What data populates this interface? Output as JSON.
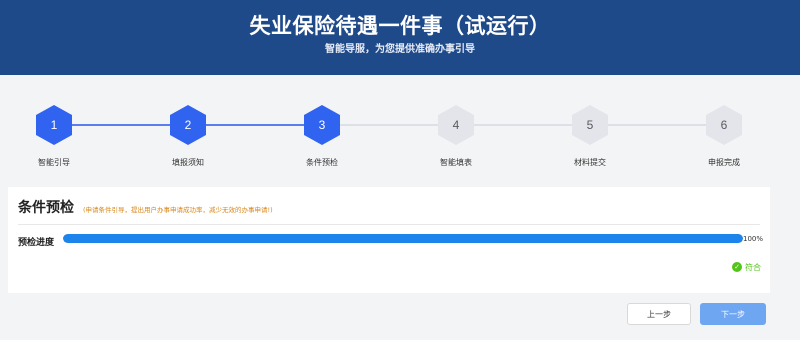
{
  "header": {
    "title": "失业保险待遇一件事（试运行）",
    "subtitle": "智能导服，为您提供准确办事引导"
  },
  "steps": [
    {
      "number": "1",
      "label": "智能引导",
      "state": "done"
    },
    {
      "number": "2",
      "label": "填报须知",
      "state": "done"
    },
    {
      "number": "3",
      "label": "条件预检",
      "state": "current"
    },
    {
      "number": "4",
      "label": "智能填表",
      "state": "todo"
    },
    {
      "number": "5",
      "label": "材料提交",
      "state": "todo"
    },
    {
      "number": "6",
      "label": "申报完成",
      "state": "todo"
    }
  ],
  "panel": {
    "title": "条件预检",
    "note": "(申请条件引导，提出用户办事申请成功率，减少无效的办事申请!)",
    "progress_label": "预检进度",
    "progress_value": 100,
    "progress_text": "100%",
    "status_text": "符合",
    "status_icon": "check-circle-icon"
  },
  "buttons": {
    "prev_label": "上一步",
    "next_label": "下一步"
  },
  "colors": {
    "header_bg": "#1f4a8a",
    "step_active": "#2f63f0",
    "step_inactive": "#e3e5ea",
    "progress": "#1c84ea",
    "status_ok": "#52c41a",
    "note": "#d9861a",
    "next_button": "#6ea6f2"
  }
}
